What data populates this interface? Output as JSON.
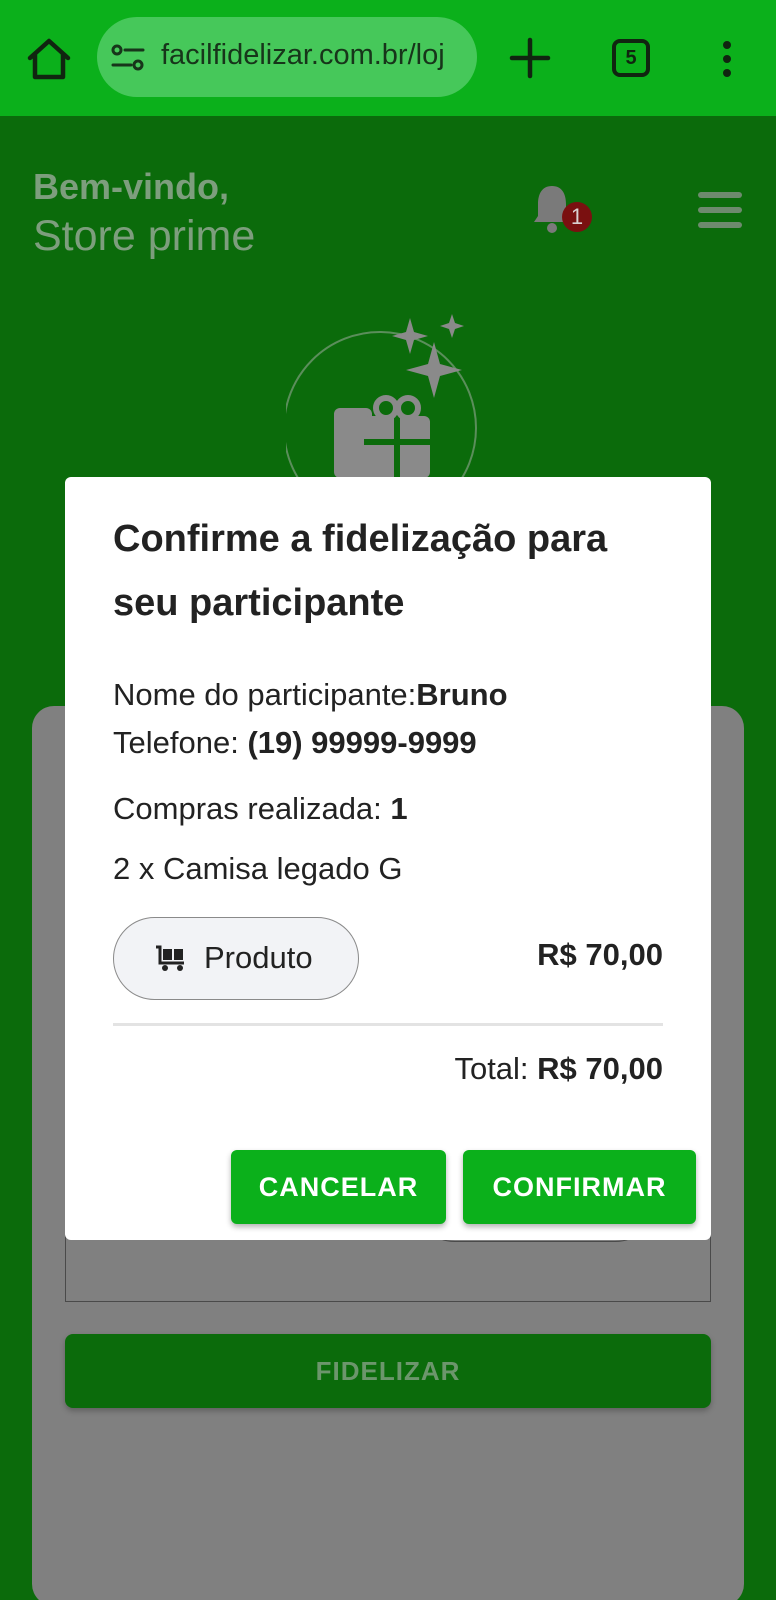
{
  "browser": {
    "url": "facilfidelizar.com.br/loj",
    "tab_count": "5"
  },
  "header": {
    "greeting": "Bem-vindo,",
    "store_name": "Store prime",
    "notification_count": "1"
  },
  "page": {
    "fidelizar_label": "FIDELIZAR"
  },
  "dialog": {
    "title": "Confirme a fidelização para seu participante",
    "name_label": "Nome do participante:",
    "name_value": "Bruno",
    "phone_label": "Telefone: ",
    "phone_value": "(19) 99999-9999",
    "purchases_label": "Compras realizada: ",
    "purchases_value": "1",
    "item_line": "2 x Camisa legado G",
    "chip_label": "Produto",
    "price": "R$ 70,00",
    "total_label": "Total: ",
    "total_value": "R$ 70,00",
    "cancel_label": "CANCELAR",
    "confirm_label": "CONFIRMAR"
  },
  "colors": {
    "browser_green": "#0bb01b",
    "page_green_dimmed": "#0b6b0b",
    "button_green": "#0bb01b",
    "badge_red": "#b71c1c"
  }
}
